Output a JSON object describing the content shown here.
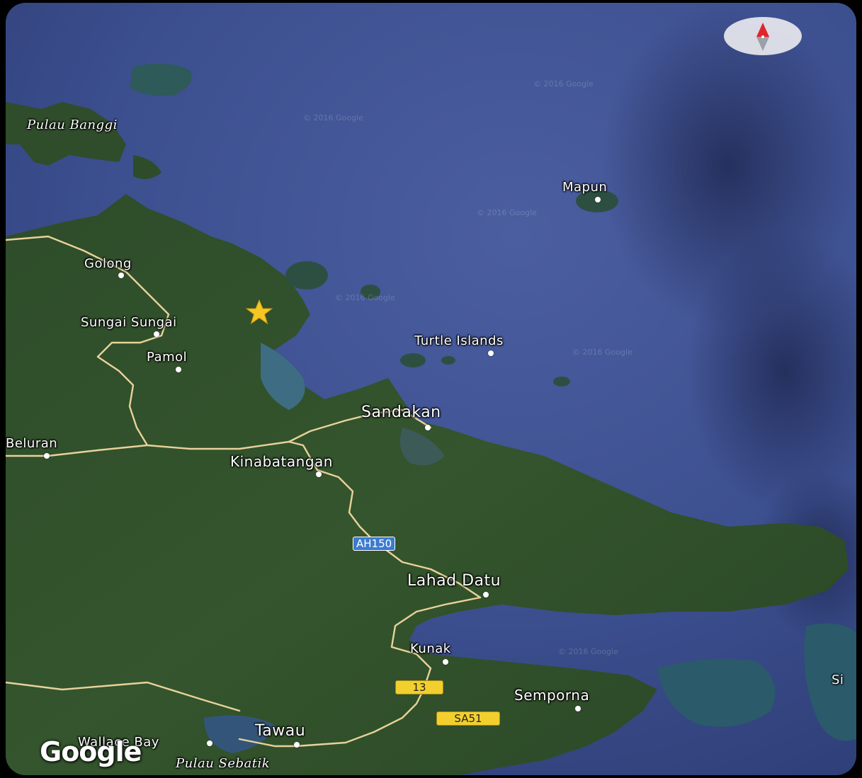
{
  "map": {
    "places": {
      "pulau_banggi": "Pulau Banggi",
      "mapun": "Mapun",
      "golong": "Golong",
      "sungai_sungai": "Sungai Sungai",
      "pamol": "Pamol",
      "turtle_islands": "Turtle Islands",
      "sandakan": "Sandakan",
      "beluran": "Beluran",
      "kinabatangan": "Kinabatangan",
      "lahad_datu": "Lahad Datu",
      "kunak": "Kunak",
      "semporna": "Semporna",
      "tawau": "Tawau",
      "wallace_bay": "Wallace Bay",
      "pulau_sebatik": "Pulau Sebatik",
      "si_partial": "Si"
    },
    "road_shields": {
      "ah150": "AH150",
      "route_13": "13",
      "sa51": "SA51"
    },
    "copyright": "© 2016 Google",
    "logo": "Google",
    "icons": {
      "marker": "star-icon",
      "compass": "compass-icon"
    },
    "colors": {
      "sea": "#3a4c8c",
      "land": "#2c4a28",
      "road": "#e8d29a",
      "star": "#f6c623",
      "compass_needle": "#e0262b"
    }
  }
}
